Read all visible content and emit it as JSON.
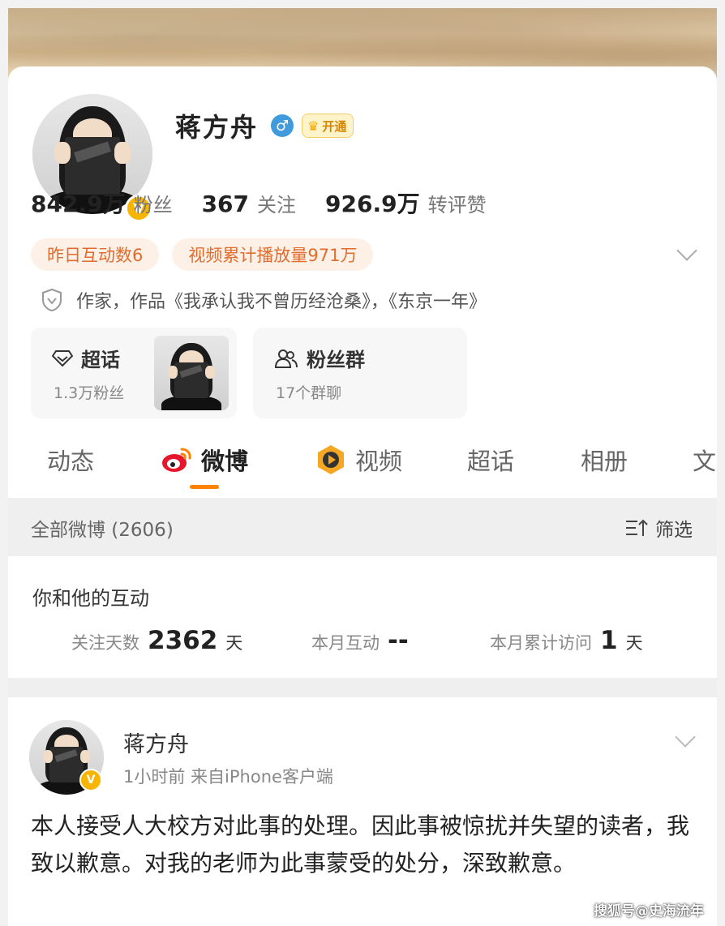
{
  "profile": {
    "name": "蒋方舟",
    "gender_symbol": "♂",
    "vip_label": "开通",
    "verified_mark": "V"
  },
  "stats": [
    {
      "value": "842.9万",
      "label": "粉丝"
    },
    {
      "value": "367",
      "label": "关注"
    },
    {
      "value": "926.9万",
      "label": "转评赞"
    }
  ],
  "tags": [
    "昨日互动数6",
    "视频累计播放量971万"
  ],
  "bio": "作家，作品《我承认我不曾历经沧桑》，《东京一年》",
  "features": {
    "chaohua": {
      "title": "超话",
      "sub": "1.3万粉丝"
    },
    "fans_group": {
      "title": "粉丝群",
      "sub": "17个群聊"
    }
  },
  "tabs": [
    "动态",
    "微博",
    "视频",
    "超话",
    "相册",
    "文"
  ],
  "filter": {
    "all_label": "全部微博 (2606)",
    "filter_label": "筛选"
  },
  "interaction": {
    "title": "你和他的互动",
    "items": [
      {
        "label": "关注天数",
        "value": "2362",
        "unit": "天"
      },
      {
        "label": "本月互动",
        "value": "--",
        "unit": ""
      },
      {
        "label": "本月累计访问",
        "value": "1",
        "unit": "天"
      }
    ]
  },
  "post": {
    "author": "蒋方舟",
    "meta": "1小时前  来自iPhone客户端",
    "content": "本人接受人大校方对此事的处理。因此事被惊扰并失望的读者，我致以歉意。对我的老师为此事蒙受的处分，深致歉意。"
  },
  "watermark": "搜狐号@史海流年",
  "colors": {
    "accent": "#ff8200",
    "tag_text": "#e06d2e",
    "tag_bg": "#fdf0e6",
    "verified": "#f7b500",
    "gender": "#3f9bdb"
  }
}
